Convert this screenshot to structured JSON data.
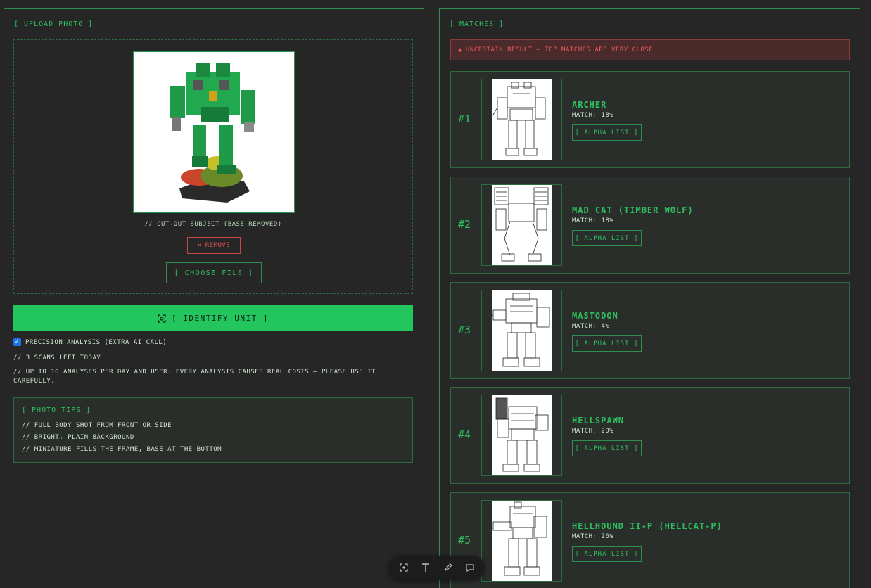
{
  "upload": {
    "title": "[ UPLOAD PHOTO ]",
    "caption": "// CUT-OUT SUBJECT (BASE REMOVED)",
    "remove_icon": "close-icon",
    "remove_label": "REMOVE",
    "choose_label": "[ CHOOSE FILE ]"
  },
  "identify": {
    "icon": "scan-icon",
    "label": "[ IDENTIFY UNIT ]"
  },
  "precision": {
    "label": "PRECISION ANALYSIS (EXTRA AI CALL)",
    "checked": true
  },
  "notes": {
    "scans_left": "// 3 SCANS LEFT TODAY",
    "limit_line1": "// UP TO 10 ANALYSES PER DAY AND USER. EVERY ANALYSIS CAUSES REAL COSTS – PLEASE USE IT",
    "limit_line2": "CAREFULLY."
  },
  "tips": {
    "title": "[ PHOTO TIPS ]",
    "items": [
      "// FULL BODY SHOT FROM FRONT OR SIDE",
      "// BRIGHT, PLAIN BACKGROUND",
      "// MINIATURE FILLS THE FRAME, BASE AT THE BOTTOM"
    ]
  },
  "matches": {
    "title": "[ MATCHES ]",
    "warning_icon": "warning-triangle-icon",
    "warning": "UNCERTAIN RESULT – TOP MATCHES ARE VERY CLOSE",
    "items": [
      {
        "rank": "#1",
        "name": "ARCHER",
        "match": "MATCH: 18%",
        "action": "[ ALPHA LIST ]"
      },
      {
        "rank": "#2",
        "name": "MAD CAT (TIMBER WOLF)",
        "match": "MATCH: 18%",
        "action": "[ ALPHA LIST ]"
      },
      {
        "rank": "#3",
        "name": "MASTODON",
        "match": "MATCH: 4%",
        "action": "[ ALPHA LIST ]"
      },
      {
        "rank": "#4",
        "name": "HELLSPAWN",
        "match": "MATCH: 20%",
        "action": "[ ALPHA LIST ]"
      },
      {
        "rank": "#5",
        "name": "HELLHOUND II-P (HELLCAT-P)",
        "match": "MATCH: 26%",
        "action": "[ ALPHA LIST ]"
      }
    ]
  },
  "toolbar": {
    "tools": [
      "select-icon",
      "text-icon",
      "pen-icon",
      "comment-icon"
    ]
  },
  "colors": {
    "accent": "#22c55e",
    "accent_text": "#2fbf5f",
    "border": "#2f8f4e",
    "danger": "#e05252",
    "background": "#262626"
  }
}
